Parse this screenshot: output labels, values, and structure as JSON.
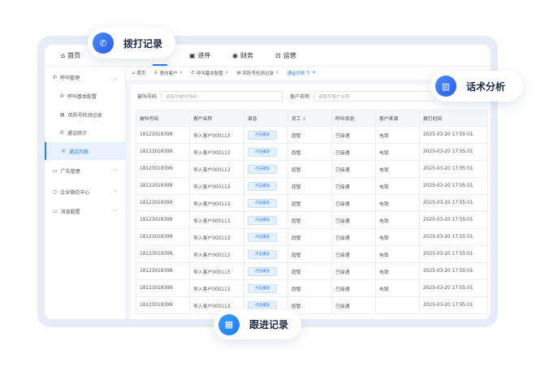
{
  "topnav": {
    "home": "首页",
    "jinjian": "进件",
    "finance": "财务",
    "ops": "运营"
  },
  "sidebar": {
    "items": [
      {
        "label": "呼叫管理"
      },
      {
        "label": "呼叫基本配置"
      },
      {
        "label": "风险号检测记录"
      },
      {
        "label": "通话统计"
      },
      {
        "label": "通话列表"
      },
      {
        "label": "广告管理"
      },
      {
        "label": "企业微信中心"
      },
      {
        "label": "消息配置"
      }
    ]
  },
  "tabs": [
    {
      "label": "首页"
    },
    {
      "label": "意向客户"
    },
    {
      "label": "呼叫基本配置"
    },
    {
      "label": "风险号检测记录"
    },
    {
      "label": "通话列表"
    }
  ],
  "filter": {
    "called_label": "被叫号码",
    "called_placeholder": "请填写被叫号码",
    "name_label": "客户名称",
    "name_placeholder": "请填写客户名称"
  },
  "table": {
    "headers": [
      "被叫号码",
      "客户名称",
      "录音",
      "员工",
      "呼叫状态",
      "客户来源",
      "拨打时间"
    ],
    "rows": [
      [
        "18123018399",
        "导入客户000113",
        "点击播放",
        "超管",
        "已接通",
        "电销",
        "2025-03-20 17:55:01"
      ],
      [
        "18123018399",
        "导入客户000113",
        "点击播放",
        "超管",
        "已接通",
        "电销",
        "2025-03-20 17:55:01"
      ],
      [
        "18123018399",
        "导入客户000113",
        "点击播放",
        "超管",
        "已接通",
        "电销",
        "2025-03-20 17:55:01"
      ],
      [
        "18123018399",
        "导入客户000113",
        "点击播放",
        "超管",
        "已接通",
        "电销",
        "2025-03-20 17:55:01"
      ],
      [
        "18123018399",
        "导入客户000113",
        "点击播放",
        "超管",
        "已接通",
        "电销",
        "2025-03-20 17:55:01"
      ],
      [
        "18123018399",
        "导入客户000113",
        "点击播放",
        "超管",
        "已接通",
        "电销",
        "2025-03-20 17:55:01"
      ],
      [
        "18123018399",
        "导入客户000113",
        "点击播放",
        "超管",
        "已接通",
        "电销",
        "2025-03-20 17:55:01"
      ],
      [
        "18123018399",
        "导入客户000113",
        "点击播放",
        "超管",
        "已接通",
        "电销",
        "2025-03-20 17:55:01"
      ],
      [
        "18123018399",
        "导入客户000113",
        "点击播放",
        "超管",
        "已接通",
        "电销",
        "2025-03-20 17:55:01"
      ],
      [
        "18123018399",
        "导入客户000113",
        "点击播放",
        "超管",
        "已接通",
        "电销",
        "2025-03-20 17:55:01"
      ],
      [
        "18123018399",
        "导入客户000113",
        "点击播放",
        "超管",
        "已接通",
        "",
        "2025-03-20 17:55:01"
      ]
    ]
  },
  "badges": {
    "dial": "拨打记录",
    "script": "话术分析",
    "follow": "跟进记录"
  },
  "colors": {
    "accent": "#2f7cf6"
  }
}
